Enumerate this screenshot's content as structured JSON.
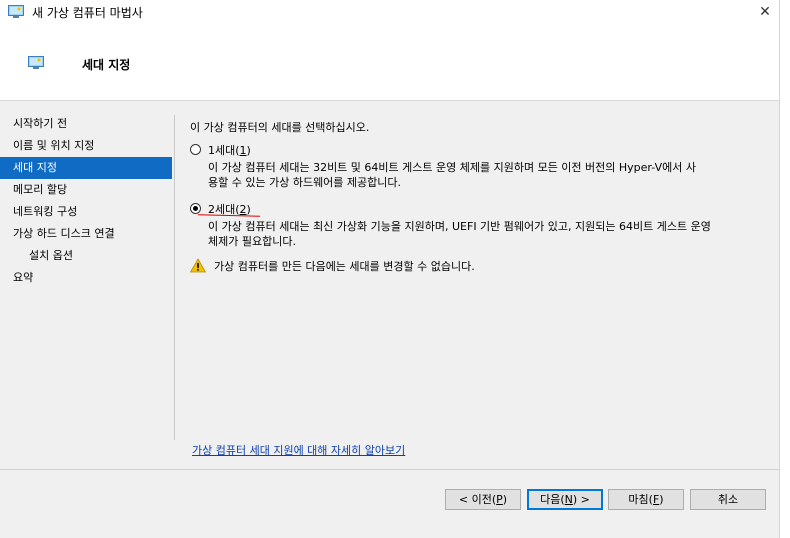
{
  "window": {
    "title": "새 가상 컴퓨터 마법사",
    "close_glyph": "✕"
  },
  "header": {
    "title": "세대 지정"
  },
  "nav": {
    "items": [
      {
        "label": "시작하기 전"
      },
      {
        "label": "이름 및 위치 지정"
      },
      {
        "label": "세대 지정"
      },
      {
        "label": "메모리 할당"
      },
      {
        "label": "네트워킹 구성"
      },
      {
        "label": "가상 하드 디스크 연결"
      },
      {
        "label": "설치 옵션"
      },
      {
        "label": "요약"
      }
    ],
    "selected_index": 2
  },
  "main": {
    "prompt": "이 가상 컴퓨터의 세대를 선택하십시오.",
    "options": [
      {
        "label_prefix": "1세대(",
        "accelerator": "1",
        "label_suffix": ")",
        "checked": false,
        "description_line1": "이 가상 컴퓨터 세대는 32비트 및 64비트 게스트 운영 체제를 지원하며 모든 이전 버전의 Hyper-V에서 사",
        "description_line2": "용할 수 있는 가상 하드웨어를 제공합니다."
      },
      {
        "label_prefix": "2세대(",
        "accelerator": "2",
        "label_suffix": ")",
        "checked": true,
        "description_line1": "이 가상 컴퓨터 세대는 최신 가상화 기능을 지원하며, UEFI 기반 펌웨어가 있고, 지원되는 64비트 게스트 운영",
        "description_line2": "체제가 필요합니다."
      }
    ],
    "warning": "가상 컴퓨터를 만든 다음에는 세대를 변경할 수 없습니다.",
    "learn_more_link": "가상 컴퓨터 세대 지원에 대해 자세히 알아보기"
  },
  "buttons": {
    "previous": {
      "prefix": "< 이전(",
      "accel": "P",
      "suffix": ")"
    },
    "next": {
      "prefix": "다음(",
      "accel": "N",
      "suffix": ") >"
    },
    "finish": {
      "prefix": "마침(",
      "accel": "F",
      "suffix": ")"
    },
    "cancel": {
      "label": "취소"
    }
  },
  "colors": {
    "nav_selected_bg": "#0f6bc4",
    "link": "#0b3fae",
    "annotation_red": "#e00000",
    "warning_yellow": "#f2c200"
  },
  "icons": {
    "title": "hyperv-vm-icon",
    "header": "hyperv-vm-icon",
    "warning": "warning-triangle-icon"
  }
}
